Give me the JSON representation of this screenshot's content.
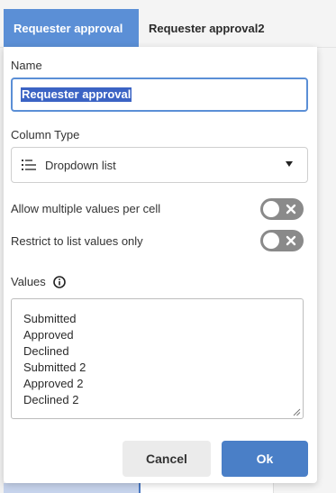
{
  "tabs": [
    {
      "label": "Requester approval",
      "active": true
    },
    {
      "label": "Requester approval2",
      "active": false
    }
  ],
  "form": {
    "name_label": "Name",
    "name_value": "Requester approval",
    "column_type_label": "Column Type",
    "column_type_value": "Dropdown list",
    "column_type_icon": "list-icon",
    "allow_multiple_label": "Allow multiple values per cell",
    "allow_multiple_enabled": false,
    "restrict_label": "Restrict to list values only",
    "restrict_enabled": false,
    "values_label": "Values",
    "values_icon": "info-icon",
    "values": [
      "Submitted",
      "Approved",
      "Declined",
      "Submitted 2",
      "Approved 2",
      "Declined 2"
    ]
  },
  "buttons": {
    "cancel": "Cancel",
    "ok": "Ok"
  },
  "colors": {
    "accent": "#5b8fd6",
    "primary_button": "#4a7fc7",
    "selection": "#3b63c4",
    "toggle_off": "#8a8a8a"
  }
}
